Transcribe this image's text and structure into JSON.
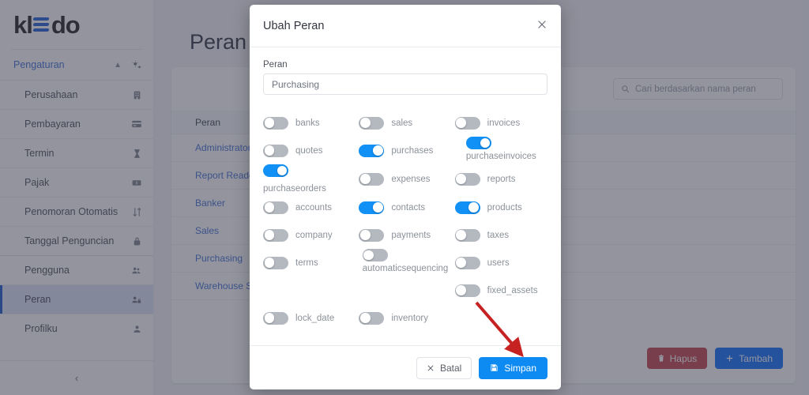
{
  "sidebar": {
    "logo_text_left": "kl",
    "logo_text_right": "do",
    "group": {
      "label": "Pengaturan",
      "chevron": "chevron-up-icon",
      "icon": "gears-icon"
    },
    "items": [
      {
        "label": "Perusahaan",
        "icon": "building-icon"
      },
      {
        "label": "Pembayaran",
        "icon": "credit-card-icon"
      },
      {
        "label": "Termin",
        "icon": "hourglass-icon"
      },
      {
        "label": "Pajak",
        "icon": "tax-icon"
      },
      {
        "label": "Penomoran Otomatis",
        "icon": "sort-icon"
      },
      {
        "label": "Tanggal Penguncian",
        "icon": "lock-icon"
      },
      {
        "label": "Pengguna",
        "icon": "users-icon"
      },
      {
        "label": "Peran",
        "icon": "user-role-icon"
      },
      {
        "label": "Profilku",
        "icon": "user-icon"
      }
    ],
    "active_item": "Peran",
    "collapse_label": "collapse-icon"
  },
  "page": {
    "title": "Peran",
    "search": {
      "placeholder": "Cari berdasarkan nama peran",
      "value": "",
      "icon": "search-icon"
    },
    "table": {
      "header": "Peran",
      "rows": [
        "Administrator",
        "Report Reader",
        "Banker",
        "Sales",
        "Purchasing",
        "Warehouse Staff"
      ]
    },
    "actions": {
      "delete_label": "Hapus",
      "delete_icon": "trash-icon",
      "add_label": "Tambah",
      "add_icon": "plus-icon"
    }
  },
  "modal": {
    "title": "Ubah Peran",
    "close_icon": "close-icon",
    "field": {
      "label": "Peran",
      "value": "Purchasing",
      "placeholder": "Peran"
    },
    "permissions": [
      {
        "label": "banks",
        "on": false
      },
      {
        "label": "sales",
        "on": false
      },
      {
        "label": "invoices",
        "on": false
      },
      {
        "label": "quotes",
        "on": false
      },
      {
        "label": "purchases",
        "on": true
      },
      {
        "label": "purchaseinvoices",
        "on": true,
        "wrap": true
      },
      {
        "label": "purchaseorders",
        "on": true
      },
      {
        "label": "expenses",
        "on": false
      },
      {
        "label": "reports",
        "on": false
      },
      {
        "label": "accounts",
        "on": false
      },
      {
        "label": "contacts",
        "on": true
      },
      {
        "label": "products",
        "on": true
      },
      {
        "label": "company",
        "on": false
      },
      {
        "label": "payments",
        "on": false
      },
      {
        "label": "taxes",
        "on": false
      },
      {
        "label": "terms",
        "on": false
      },
      {
        "label": "automaticsequencing",
        "on": false,
        "wrap": true
      },
      {
        "label": "users",
        "on": false
      },
      {
        "label": "",
        "on": null,
        "empty": true
      },
      {
        "label": "",
        "on": null,
        "empty": true
      },
      {
        "label": "fixed_assets",
        "on": false
      },
      {
        "label": "lock_date",
        "on": false
      },
      {
        "label": "inventory",
        "on": false
      },
      {
        "label": "",
        "on": null,
        "empty": true
      }
    ],
    "footer": {
      "cancel_label": "Batal",
      "cancel_icon": "close-icon",
      "save_label": "Simpan",
      "save_icon": "save-disk-icon"
    }
  },
  "annotation": {
    "arrow": "red-arrow-pointing-to-save-button",
    "color": "#c62222"
  },
  "colors": {
    "accent_blue": "#1190f5",
    "primary_blue": "#0d6efd",
    "danger_red": "#c4404a",
    "toggle_off": "#b4b9c0",
    "overlay": "rgba(58,60,78,.55)"
  }
}
